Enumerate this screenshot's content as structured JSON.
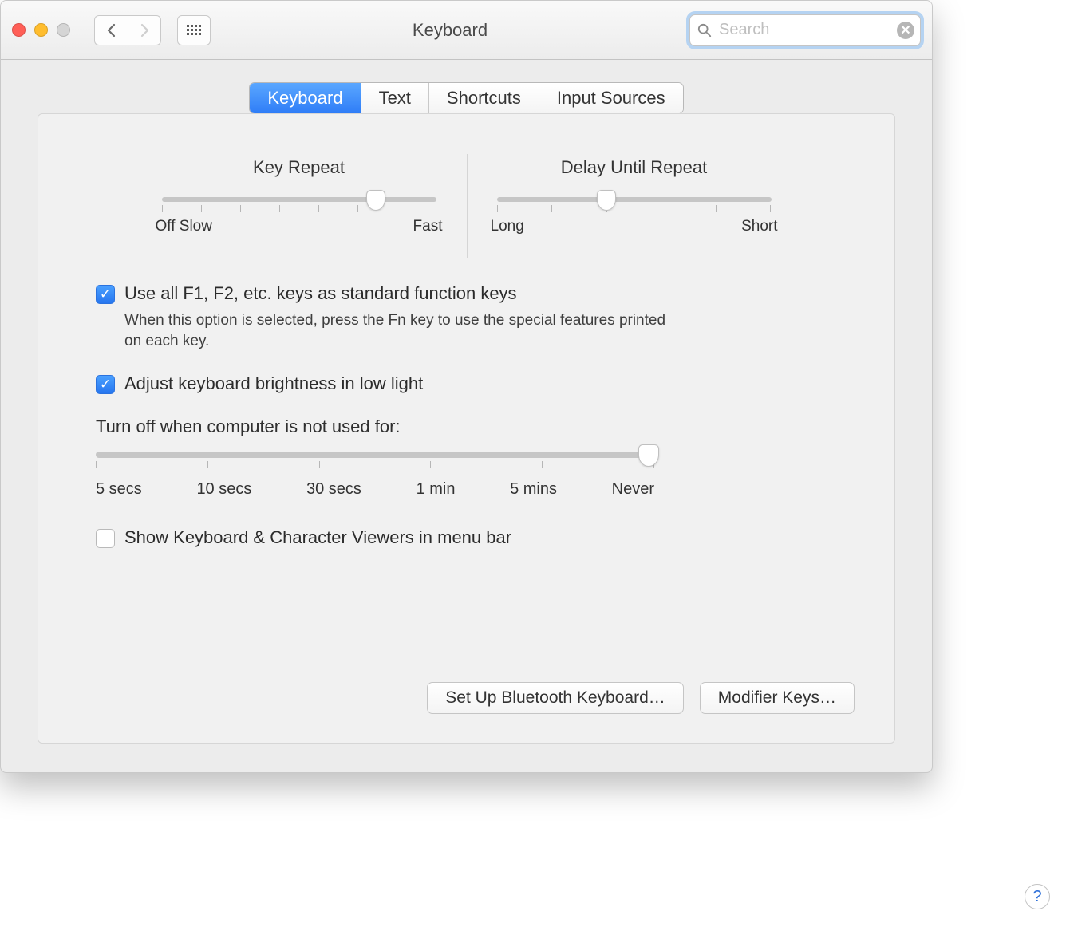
{
  "window": {
    "title": "Keyboard"
  },
  "search": {
    "placeholder": "Search"
  },
  "tabs": [
    {
      "label": "Keyboard",
      "active": true
    },
    {
      "label": "Text",
      "active": false
    },
    {
      "label": "Shortcuts",
      "active": false
    },
    {
      "label": "Input Sources",
      "active": false
    }
  ],
  "sliders": {
    "keyRepeat": {
      "title": "Key Repeat",
      "leftLabel": "Off",
      "leftLabel2": "Slow",
      "rightLabel": "Fast",
      "tickCount": 8,
      "valuePercent": 78
    },
    "delayUntilRepeat": {
      "title": "Delay Until Repeat",
      "leftLabel": "Long",
      "rightLabel": "Short",
      "tickCount": 6,
      "valuePercent": 40
    }
  },
  "options": {
    "fnKeys": {
      "checked": true,
      "label": "Use all F1, F2, etc. keys as standard function keys",
      "help": "When this option is selected, press the Fn key to use the special features printed on each key."
    },
    "brightness": {
      "checked": true,
      "label": "Adjust keyboard brightness in low light"
    },
    "turnOff": {
      "label": "Turn off when computer is not used for:",
      "ticks": [
        "5 secs",
        "10 secs",
        "30 secs",
        "1 min",
        "5 mins",
        "Never"
      ],
      "valuePercent": 100
    },
    "showViewers": {
      "checked": false,
      "label": "Show Keyboard & Character Viewers in menu bar"
    }
  },
  "buttons": {
    "bluetooth": "Set Up Bluetooth Keyboard…",
    "modifier": "Modifier Keys…"
  },
  "help": "?"
}
